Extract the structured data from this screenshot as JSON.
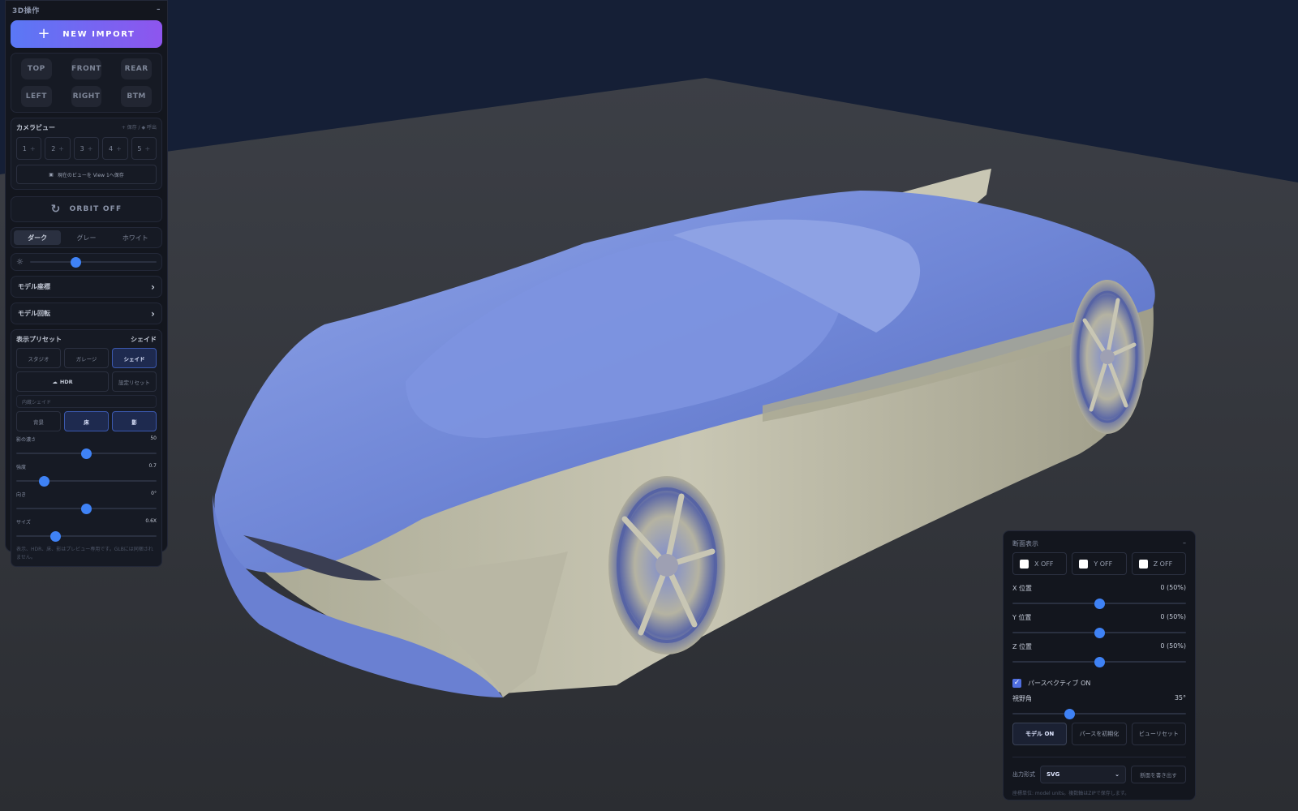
{
  "panel": {
    "title": "3D操作",
    "collapse": "–",
    "import_label": "NEW IMPORT",
    "view_buttons": [
      "TOP",
      "FRONT",
      "REAR",
      "LEFT",
      "RIGHT",
      "BTM"
    ],
    "camera": {
      "title": "カメラビュー",
      "hint": "+ 保存 / ◆ 呼出",
      "slots": [
        "1",
        "2",
        "3",
        "4",
        "5"
      ],
      "slot_plus": "+",
      "save_label": "現在のビューを View 1へ保存"
    },
    "orbit_label": "ORBIT OFF",
    "themes": [
      "ダーク",
      "グレー",
      "ホワイト"
    ],
    "active_theme": 0,
    "brightness": 0.36,
    "model_coords": "モデル座標",
    "model_rotation": "モデル回転",
    "preset": {
      "title": "表示プリセット",
      "current": "シェイド",
      "options": [
        "スタジオ",
        "ガレージ",
        "シェイド"
      ],
      "selected": 2,
      "hdr_label": "HDR",
      "reset_label": "設定リセット",
      "builtin_label": "内蔵シェイド",
      "toggles": [
        "背景",
        "床",
        "影"
      ],
      "toggles_on": [
        false,
        true,
        true
      ]
    },
    "sliders": [
      {
        "label": "影の濃さ",
        "value": "50",
        "fraction": 0.5
      },
      {
        "label": "強度",
        "value": "0.7",
        "fraction": 0.2
      },
      {
        "label": "向き",
        "value": "0°",
        "fraction": 0.5
      },
      {
        "label": "サイズ",
        "value": "0.6X",
        "fraction": 0.28
      }
    ],
    "note": "表示、HDR、床、影はプレビュー専用です。GLBには同梱されません。"
  },
  "section": {
    "title": "断面表示",
    "collapse": "–",
    "axes": [
      {
        "label": "X OFF",
        "checked": false
      },
      {
        "label": "Y OFF",
        "checked": false
      },
      {
        "label": "Z OFF",
        "checked": false
      }
    ],
    "positions": [
      {
        "label": "X 位置",
        "value": "0 (50%)",
        "fraction": 0.5
      },
      {
        "label": "Y 位置",
        "value": "0 (50%)",
        "fraction": 0.5
      },
      {
        "label": "Z 位置",
        "value": "0 (50%)",
        "fraction": 0.5
      }
    ],
    "perspective_label": "パースペクティブ ON",
    "perspective_checked": true,
    "fov": {
      "label": "視野角",
      "value": "35°",
      "fraction": 0.33
    },
    "buttons": [
      "モデル ON",
      "パースを初期化",
      "ビューリセット"
    ],
    "selected_button": 0,
    "export_label": "出力形式",
    "format": "SVG",
    "export_button": "断面を書き出す",
    "note": "座標単位: model units。複数軸はZIPで保存します。"
  },
  "colors": {
    "accent": "#3f82f5",
    "import_gradient_start": "#5a78f5",
    "import_gradient_end": "#8e55ee",
    "floor": "#3a3d44",
    "background": "#151f36"
  }
}
